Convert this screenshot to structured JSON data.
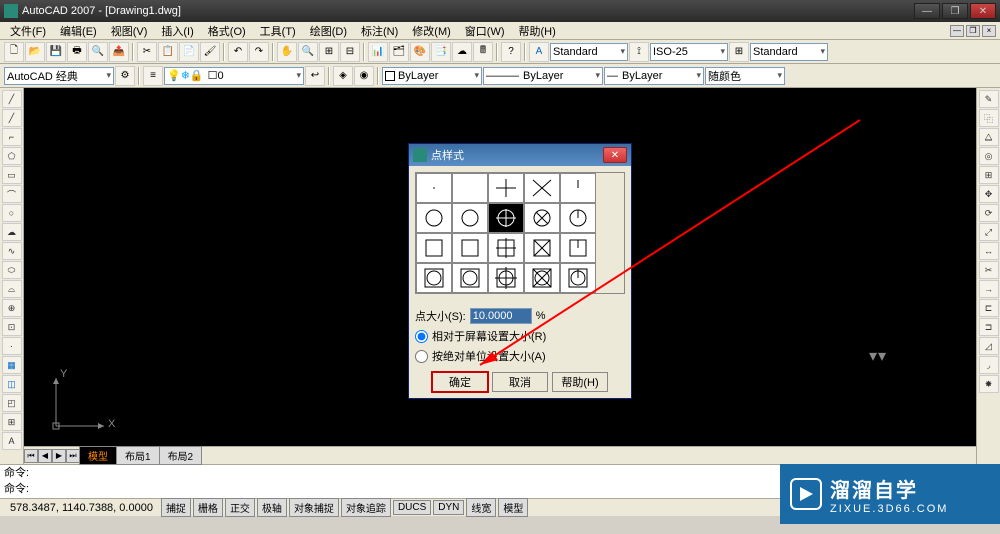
{
  "app": {
    "title": "AutoCAD 2007 - [Drawing1.dwg]"
  },
  "menu": [
    "文件(F)",
    "编辑(E)",
    "视图(V)",
    "插入(I)",
    "格式(O)",
    "工具(T)",
    "绘图(D)",
    "标注(N)",
    "修改(M)",
    "窗口(W)",
    "帮助(H)"
  ],
  "toolbar1": {
    "style1": "Standard",
    "style2": "ISO-25",
    "style3": "Standard"
  },
  "toolbar2": {
    "workspace": "AutoCAD 经典",
    "layer": "0",
    "color_prop": "ByLayer",
    "linetype": "ByLayer",
    "lineweight": "ByLayer",
    "plotcolor": "随颜色"
  },
  "dialog": {
    "title": "点样式",
    "size_label": "点大小(S):",
    "size_value": "10.0000",
    "size_unit": "%",
    "radio1": "相对于屏幕设置大小(R)",
    "radio2": "按绝对单位设置大小(A)",
    "ok": "确定",
    "cancel": "取消",
    "help": "帮助(H)"
  },
  "tabs": {
    "model": "模型",
    "layout1": "布局1",
    "layout2": "布局2"
  },
  "cmd": {
    "line1": "命令:",
    "line2": "命令:"
  },
  "status": {
    "coords": "578.3487, 1140.7388, 0.0000",
    "buttons": [
      "捕捉",
      "栅格",
      "正交",
      "极轴",
      "对象捕捉",
      "对象追踪",
      "DUCS",
      "DYN",
      "线宽",
      "模型"
    ]
  },
  "ucs": {
    "x": "X",
    "y": "Y"
  },
  "watermark": {
    "main": "溜溜自学",
    "sub": "ZIXUE.3D66.COM"
  }
}
